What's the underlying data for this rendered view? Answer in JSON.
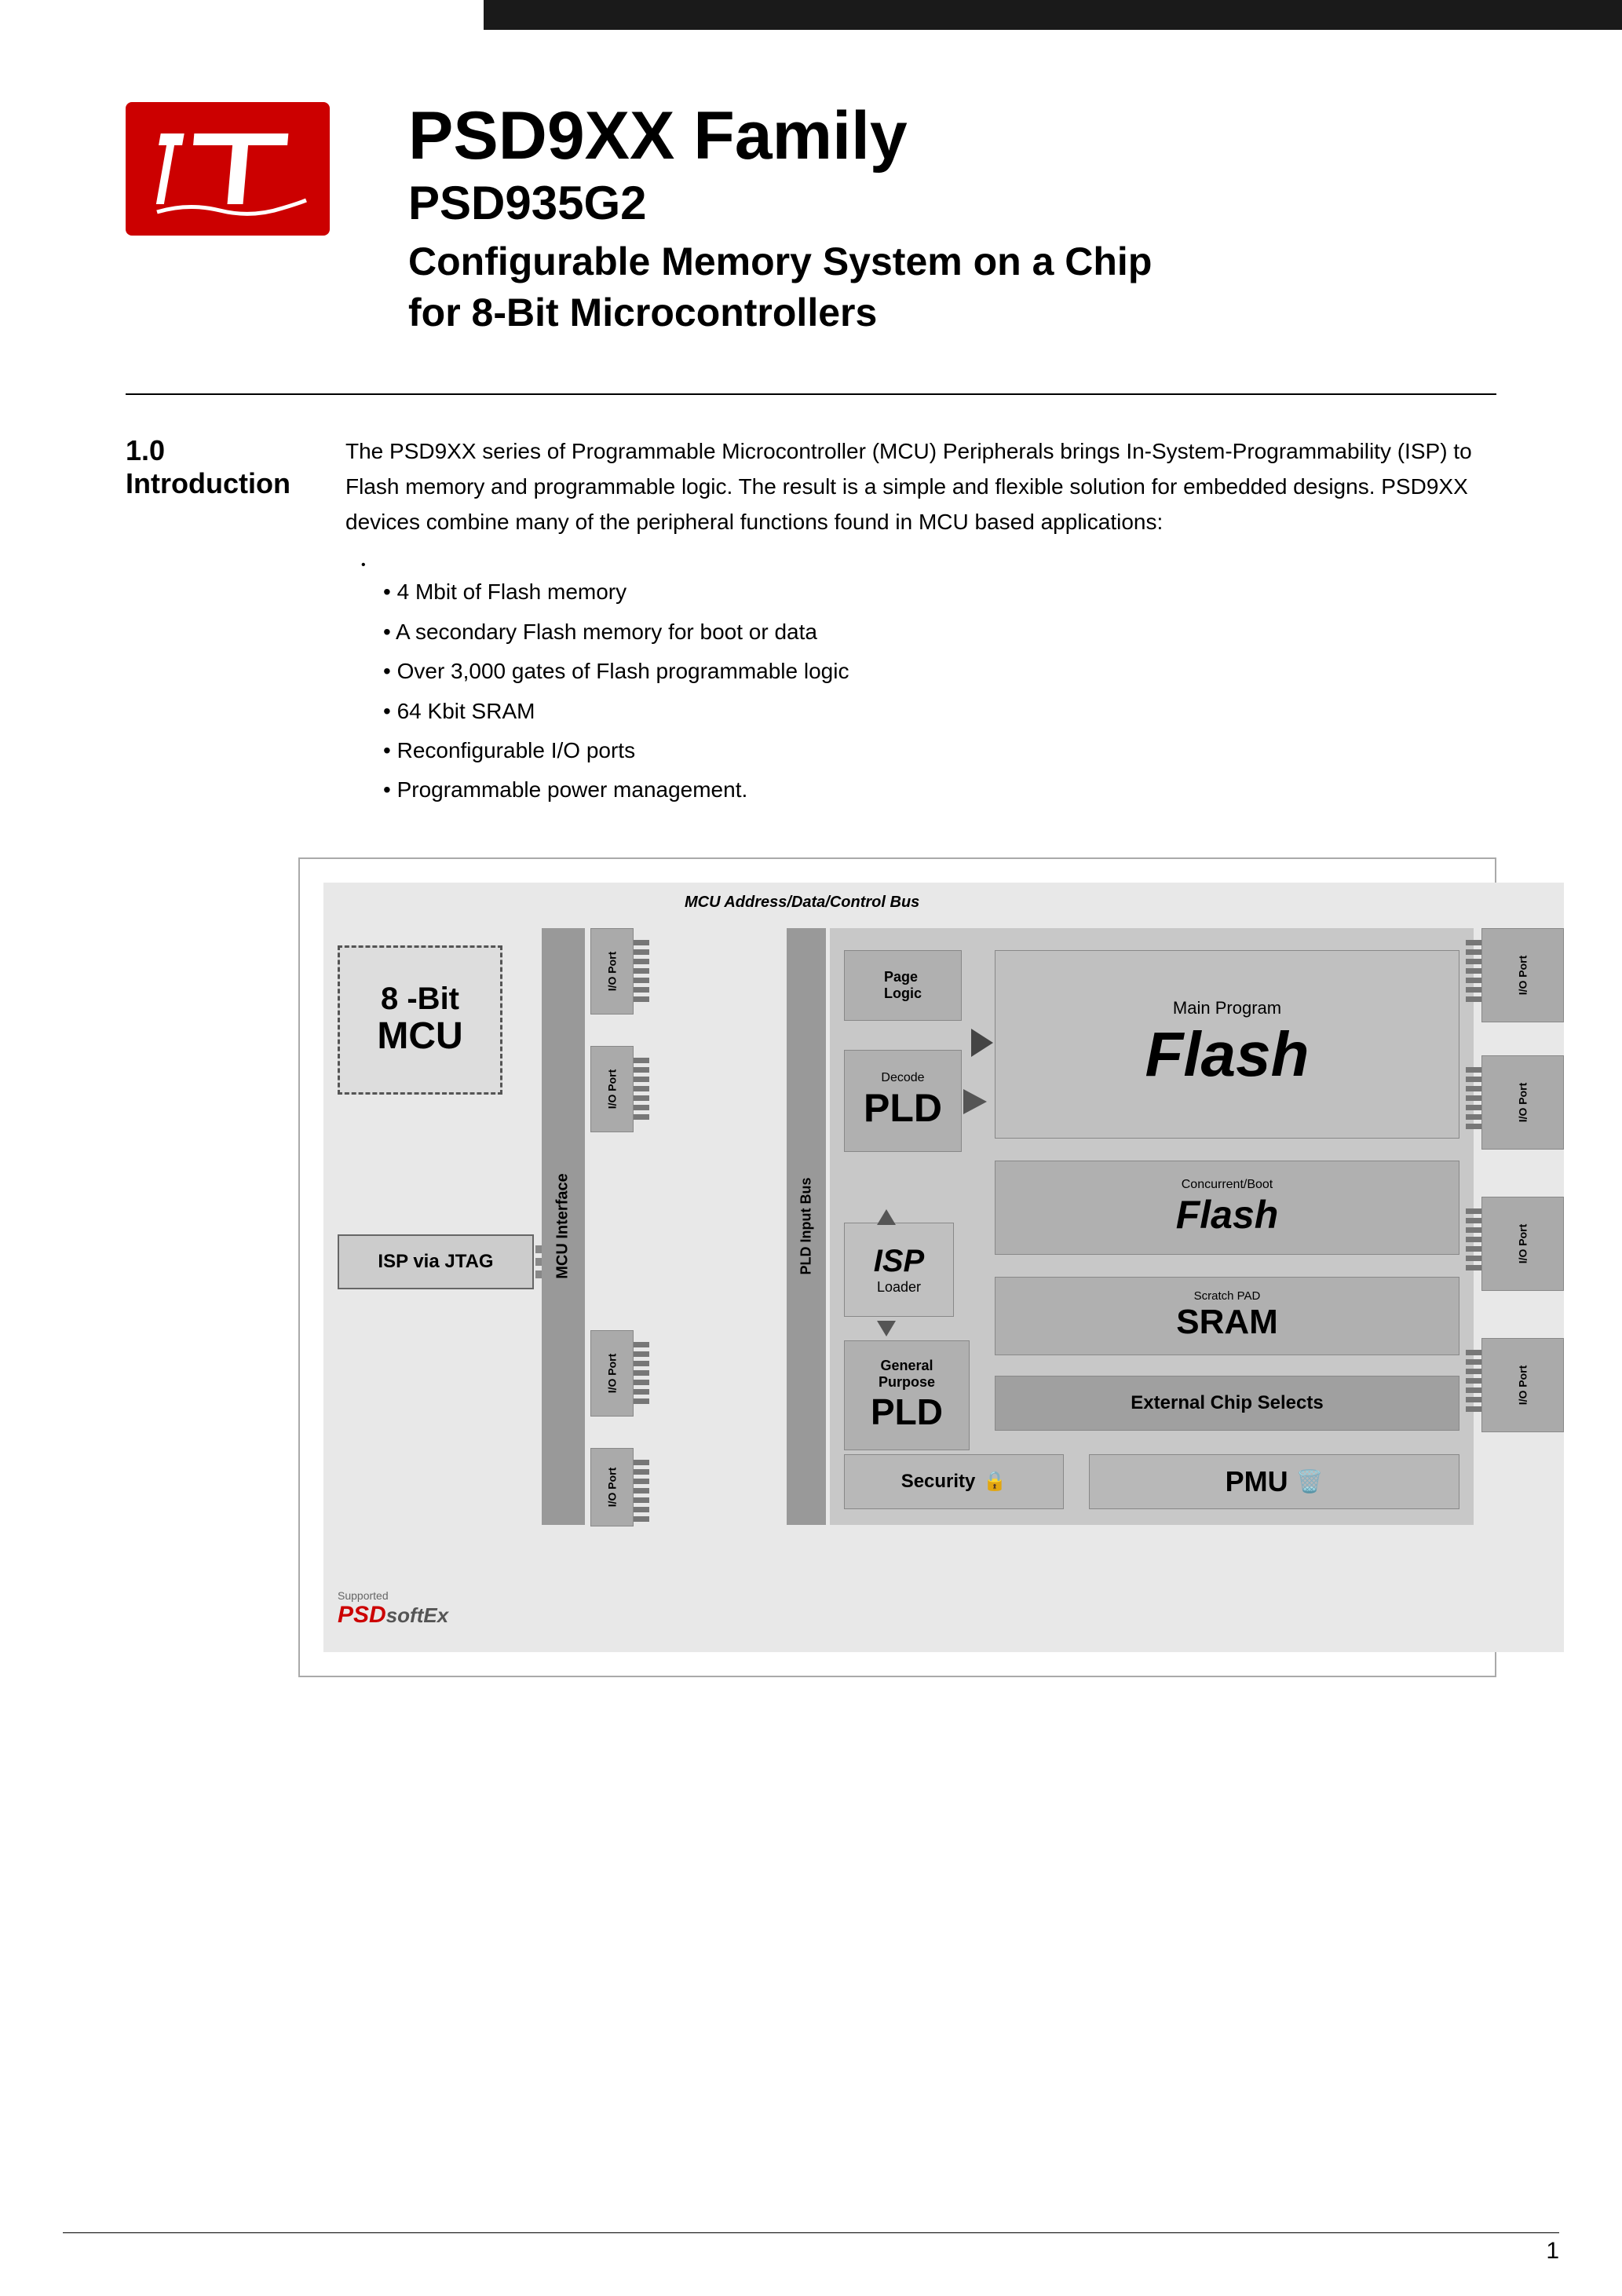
{
  "header": {
    "top_bar_color": "#1a1a1a",
    "main_title": "PSD9XX Family",
    "subtitle_model": "PSD935G2",
    "subtitle_desc_line1": "Configurable Memory System on a Chip",
    "subtitle_desc_line2": "for 8-Bit Microcontrollers"
  },
  "section": {
    "number": "1.0",
    "title": "Introduction",
    "paragraph": "The PSD9XX series of Programmable Microcontroller (MCU) Peripherals brings In-System-Programmability (ISP) to Flash memory and programmable logic. The result is a simple and flexible solution for embedded designs. PSD9XX devices combine many of the peripheral functions found in MCU based applications:",
    "bullets": [
      "4 Mbit of Flash memory",
      "A secondary Flash memory for boot or data",
      "Over 3,000 gates of Flash programmable logic",
      "64 Kbit SRAM",
      "Reconfigurable I/O ports",
      "Programmable power management."
    ]
  },
  "diagram": {
    "bus_label": "MCU Address/Data/Control Bus",
    "mcu_block": {
      "line1": "8 -Bit",
      "line2": "MCU"
    },
    "isp_jtag": "ISP via JTAG",
    "mcu_interface": "MCU Interface",
    "pld_input_bus": "PLD Input Bus",
    "page_logic": {
      "line1": "Page",
      "line2": "Logic"
    },
    "decode_pld": {
      "label": "Decode",
      "main": "PLD"
    },
    "isp_loader": {
      "main": "ISP",
      "sub": "Loader"
    },
    "gp_pld": {
      "line1": "General",
      "line2": "Purpose",
      "main": "PLD"
    },
    "main_flash": {
      "label": "Main Program",
      "main": "Flash"
    },
    "boot_flash": {
      "label": "Concurrent/Boot",
      "main": "Flash"
    },
    "sram": {
      "label": "Scratch PAD",
      "main": "SRAM"
    },
    "ext_chip": "External Chip Selects",
    "security": "Security",
    "pmu": "PMU",
    "io_port": "I/O Port",
    "supported_label": "Supported",
    "psdsoflex_logo": "PSDsoftEx"
  },
  "footer": {
    "page_number": "1"
  }
}
